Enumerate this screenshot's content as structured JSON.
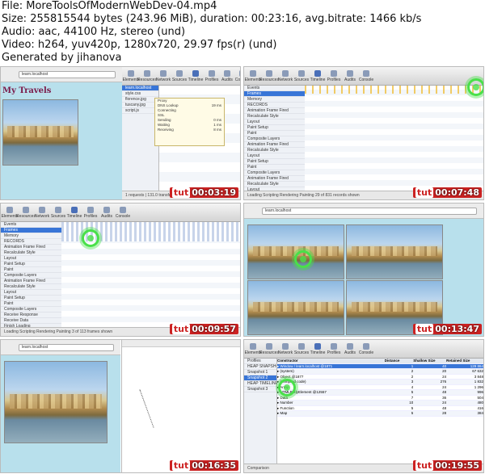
{
  "info": {
    "file": "File: MoreToolsOfModernWebDev-04.mp4",
    "size": "Size: 255815544 bytes (243.96 MiB), duration: 00:23:16, avg.bitrate: 1466 kb/s",
    "audio": "Audio: aac, 44100 Hz, stereo (und)",
    "video": "Video: h264, yuv420p, 1280x720, 29.97 fps(r) (und)",
    "generated": "Generated by jihanova"
  },
  "colors": {
    "timestamp_bg": "#cc2222",
    "target_ring": "#49e049",
    "selection": "#3875d7"
  },
  "thumbnails": [
    {
      "timestamp": "00:03:19",
      "page_title": "My Travels",
      "toolbar": [
        "Elements",
        "Resources",
        "Network",
        "Sources",
        "Timeline",
        "Profiles",
        "Audits",
        "Console"
      ],
      "resources": [
        "learn.localhost",
        "style.css",
        "florence.jpg",
        "tuscany.jpg",
        "script.js"
      ],
      "popup_rows": [
        {
          "label": "Proxy",
          "value": ""
        },
        {
          "label": "DNS Lookup",
          "value": "19 ms"
        },
        {
          "label": "Connecting",
          "value": ""
        },
        {
          "label": "SSL",
          "value": ""
        },
        {
          "label": "Sending",
          "value": "0 ms"
        },
        {
          "label": "Waiting",
          "value": "1 ms"
        },
        {
          "label": "Receiving",
          "value": "8 ms"
        }
      ],
      "status": "1 requests | 131.0 transferred | 38 ms (load: 77 ms)"
    },
    {
      "timestamp": "00:07:48",
      "toolbar": [
        "Elements",
        "Resources",
        "Network",
        "Sources",
        "Timeline",
        "Profiles",
        "Audits",
        "Console"
      ],
      "sidebar": [
        "Events",
        "Frames",
        "Memory",
        "RECORDS",
        "Animation Frame Fired",
        "Recalculate Style",
        "Layout",
        "Paint Setup",
        "Paint",
        "Composite Layers",
        "Animation Frame Fired",
        "Recalculate Style",
        "Layout",
        "Paint Setup",
        "Paint",
        "Composite Layers",
        "Animation Frame Fired",
        "Recalculate Style",
        "Layout",
        "Paint",
        "Composite Layers"
      ],
      "status": "Loading  Scripting  Rendering  Painting   29 of 831 records shown"
    },
    {
      "timestamp": "00:09:57",
      "toolbar": [
        "Elements",
        "Resources",
        "Network",
        "Sources",
        "Timeline",
        "Profiles",
        "Audits",
        "Console"
      ],
      "sidebar": [
        "Events",
        "Frames",
        "Memory",
        "RECORDS",
        "Animation Frame Fired",
        "Recalculate Style",
        "Layout",
        "Paint Setup",
        "Paint",
        "Composite Layers",
        "Animation Frame Fired",
        "Recalculate Style",
        "Layout",
        "Paint Setup",
        "Paint",
        "Composite Layers",
        "Receive Response",
        "Receive Data",
        "Finish Loading",
        "Parse HTML",
        "Receive Response",
        "Finish Loading"
      ],
      "status": "Loading  Scripting  Rendering  Painting   3 of 113 frames shown"
    },
    {
      "timestamp": "00:13:47",
      "url": "learn.localhost"
    },
    {
      "timestamp": "00:16:35",
      "url": "learn.localhost"
    },
    {
      "timestamp": "00:19:55",
      "toolbar": [
        "Elements",
        "Resources",
        "Network",
        "Sources",
        "Timeline",
        "Profiles",
        "Audits",
        "Console"
      ],
      "sidebar": [
        "Profiles",
        "HEAP SNAPSHOTS",
        "Snapshot 1",
        "Snapshot 2",
        "HEAP TIMELINES",
        "Snapshot 3"
      ],
      "heap_header": [
        "Constructor",
        "Distance",
        "Shallow Size",
        "Retained Size"
      ],
      "heap_rows": [
        [
          "▸ Window / learn.localhost @1871",
          "1",
          "40",
          "129 864"
        ],
        [
          "▸ (system)",
          "2",
          "20",
          "67 632"
        ],
        [
          "▸ Object @1877",
          "2",
          "24",
          "3 848"
        ],
        [
          "▸ (compiled code)",
          "3",
          "276",
          "1 832"
        ],
        [
          "▸ Array",
          "4",
          "24",
          "1 296"
        ],
        [
          "▸ HTMLBodyElement @12557",
          "5",
          "48",
          "996"
        ],
        [
          "▸ Data",
          "7",
          "36",
          "504"
        ],
        [
          "▸ Number",
          "10",
          "24",
          "480"
        ],
        [
          "▸ Function",
          "5",
          "48",
          "416"
        ],
        [
          "▸ Map",
          "5",
          "28",
          "384"
        ]
      ],
      "status": "Comparison"
    }
  ]
}
